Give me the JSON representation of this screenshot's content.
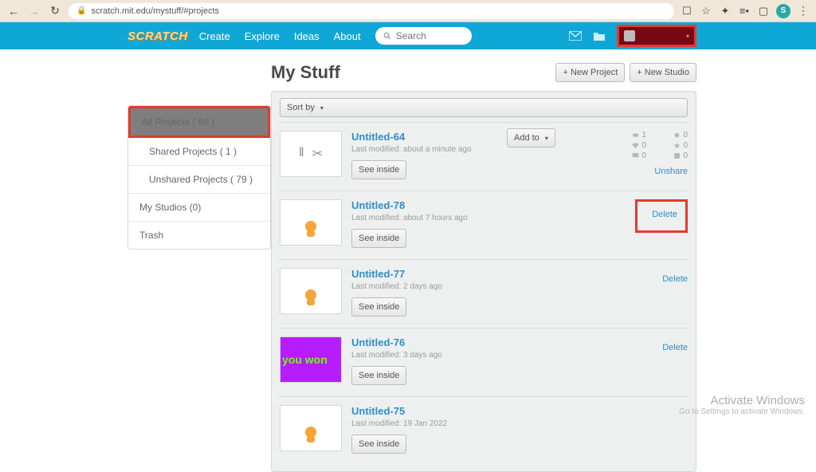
{
  "browser": {
    "url": "scratch.mit.edu/mystuff/#projects",
    "avatar_initial": "S"
  },
  "topnav": {
    "logo": "SCRATCH",
    "links": {
      "create": "Create",
      "explore": "Explore",
      "ideas": "Ideas",
      "about": "About"
    },
    "search_placeholder": "Search"
  },
  "page": {
    "title": "My Stuff",
    "new_project": "+ New Project",
    "new_studio": "+ New Studio",
    "sort_by": "Sort by"
  },
  "sidebar": {
    "all_projects": "All Projects ( 80 )",
    "shared": "Shared Projects ( 1 )",
    "unshared": "Unshared Projects ( 79 )",
    "my_studios": "My Studios (0)",
    "trash": "Trash"
  },
  "buttons": {
    "add_to": "Add to",
    "see_inside": "See inside",
    "unshare": "Unshare",
    "delete": "Delete"
  },
  "projects": [
    {
      "title": "Untitled-64",
      "meta": "Last modified: about a minute ago",
      "shared": true,
      "thumb": "scissors",
      "stats": {
        "views": "1",
        "remixes": "0",
        "loves": "0",
        "favorites": "0",
        "comments": "0",
        "studios": "0"
      }
    },
    {
      "title": "Untitled-78",
      "meta": "Last modified: about 7 hours ago",
      "shared": false,
      "thumb": "cat"
    },
    {
      "title": "Untitled-77",
      "meta": "Last modified: 2 days ago",
      "shared": false,
      "thumb": "cat"
    },
    {
      "title": "Untitled-76",
      "meta": "Last modified: 3 days ago",
      "shared": false,
      "thumb": "purple",
      "thumb_text": "you won"
    },
    {
      "title": "Untitled-75",
      "meta": "Last modified: 19 Jan 2022",
      "shared": false,
      "thumb": "cat"
    }
  ],
  "watermark": {
    "line1": "Activate Windows",
    "line2": "Go to Settings to activate Windows."
  }
}
